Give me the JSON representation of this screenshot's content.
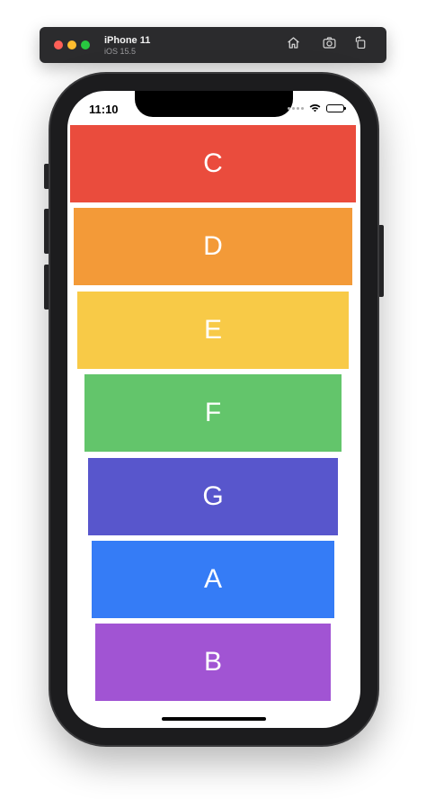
{
  "simulator": {
    "device_name": "iPhone 11",
    "os_version": "iOS 15.5",
    "toolbar_icons": [
      "home-icon",
      "screenshot-icon",
      "rotate-icon"
    ]
  },
  "status_bar": {
    "time": "11:10",
    "icons": [
      "signal-icon",
      "wifi-icon",
      "battery-icon"
    ]
  },
  "cards": [
    {
      "label": "C",
      "color": "#ea4c3d"
    },
    {
      "label": "D",
      "color": "#f39a38"
    },
    {
      "label": "E",
      "color": "#f8ca47"
    },
    {
      "label": "F",
      "color": "#63c56b"
    },
    {
      "label": "G",
      "color": "#5856cc"
    },
    {
      "label": "A",
      "color": "#357cf6"
    },
    {
      "label": "B",
      "color": "#a154d3"
    }
  ]
}
